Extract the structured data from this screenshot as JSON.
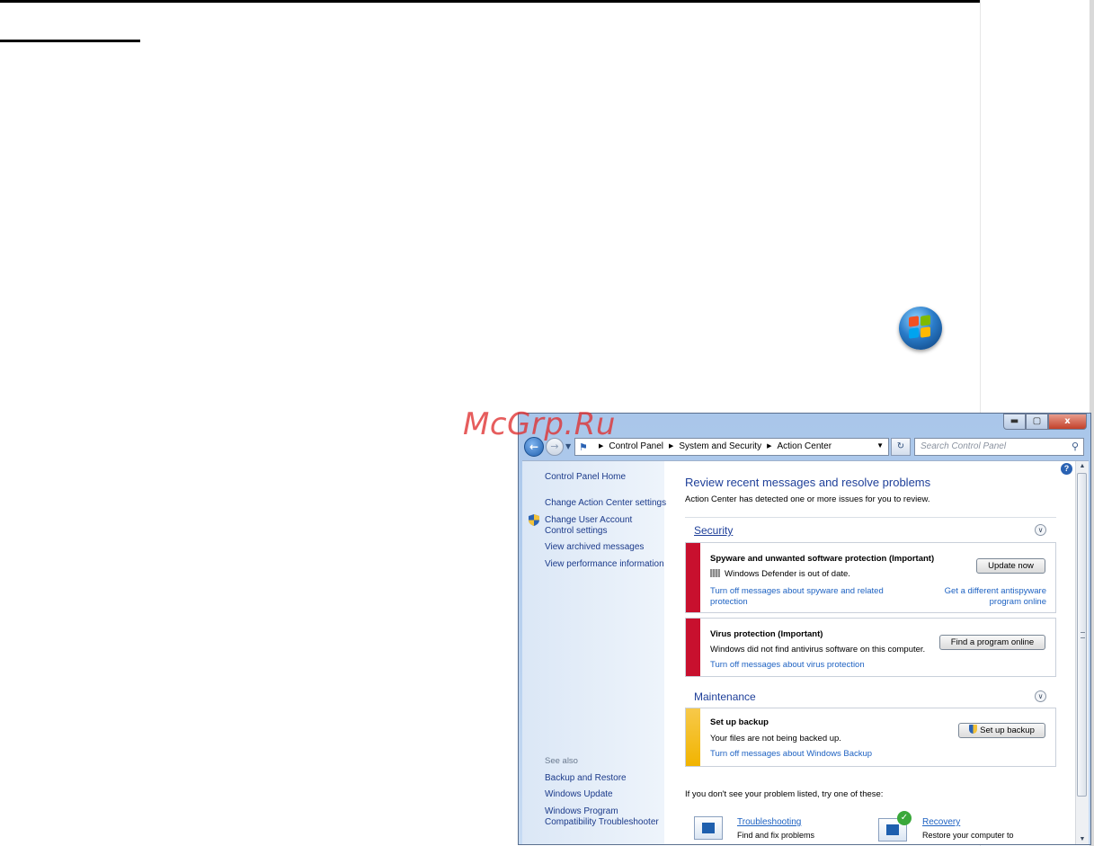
{
  "watermark": "McGrp.Ru",
  "window": {
    "controls": {
      "minimize": "▬",
      "maximize": "▢",
      "close": "x"
    },
    "address": {
      "crumbs": [
        "Control Panel",
        "System and Security",
        "Action Center"
      ]
    },
    "search": {
      "placeholder": "Search Control Panel"
    }
  },
  "sidebar": {
    "home": "Control Panel Home",
    "items": [
      "Change Action Center settings",
      "Change User Account Control settings",
      "View archived messages",
      "View performance information"
    ],
    "see_also_label": "See also",
    "see_also": [
      "Backup and Restore",
      "Windows Update",
      "Windows Program Compatibility Troubleshooter"
    ]
  },
  "main": {
    "title": "Review recent messages and resolve problems",
    "subtitle": "Action Center has detected one or more issues for you to review.",
    "security": {
      "heading": "Security",
      "spyware": {
        "title": "Spyware and unwanted software protection (Important)",
        "text": "Windows Defender is out of date.",
        "button": "Update now",
        "link_off": "Turn off messages about spyware and related protection",
        "link_alt": "Get a different antispyware program online"
      },
      "virus": {
        "title": "Virus protection (Important)",
        "text": "Windows did not find antivirus software on this computer.",
        "button": "Find a program online",
        "link_off": "Turn off messages about virus protection"
      }
    },
    "maintenance": {
      "heading": "Maintenance",
      "backup": {
        "title": "Set up backup",
        "text": "Your files are not being backed up.",
        "button": "Set up backup",
        "link_off": "Turn off messages about Windows Backup"
      }
    },
    "hint": "If you don't see your problem listed, try one of these:",
    "tools": [
      {
        "label": "Troubleshooting",
        "sub": "Find and fix problems"
      },
      {
        "label": "Recovery",
        "sub": "Restore your computer to"
      }
    ]
  },
  "colors": {
    "important": "#c8102e",
    "warning": "#f1b400",
    "link": "#1e62c2",
    "heading": "#1e3f99"
  }
}
